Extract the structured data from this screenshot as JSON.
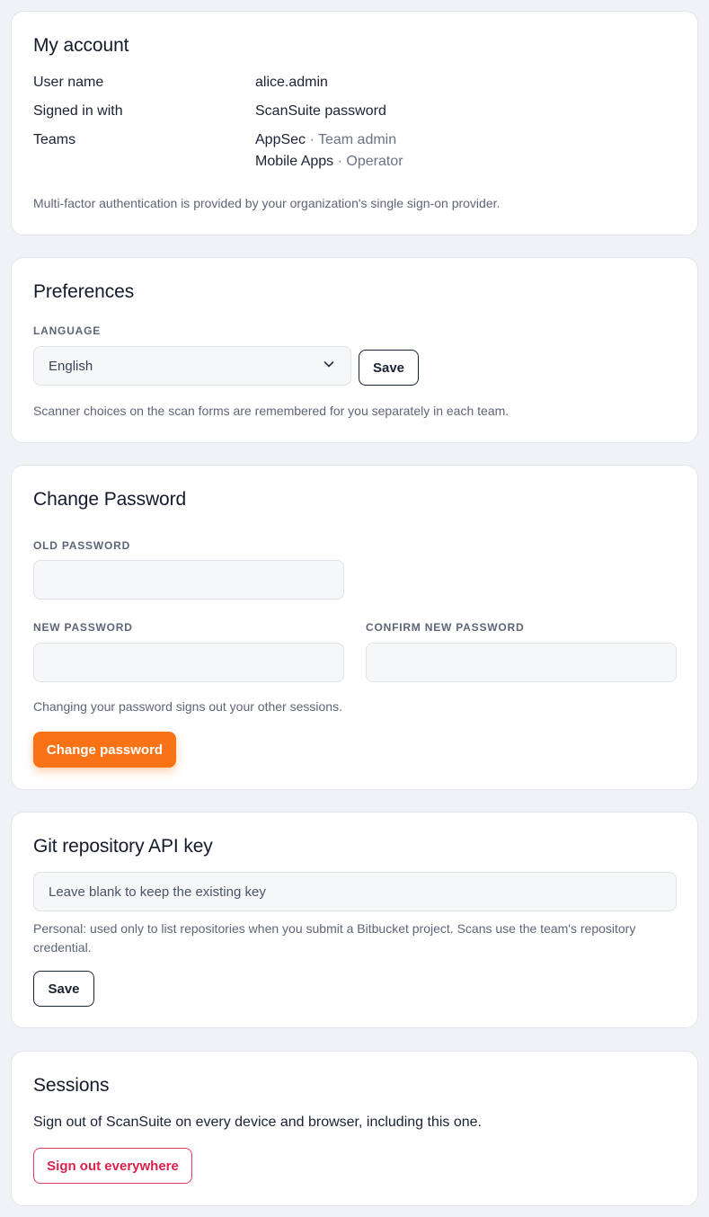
{
  "account": {
    "title": "My account",
    "rows": [
      {
        "key": "User name",
        "value": "alice.admin"
      },
      {
        "key": "Signed in with",
        "value": "ScanSuite password"
      },
      {
        "key": "Teams",
        "value": ""
      }
    ],
    "teams": [
      {
        "name": "AppSec",
        "sep": " · ",
        "role": "Team admin"
      },
      {
        "name": "Mobile Apps",
        "sep": " · ",
        "role": "Operator"
      }
    ],
    "mfa_note": "Multi-factor authentication is provided by your organization's single sign-on provider."
  },
  "preferences": {
    "title": "Preferences",
    "language_label": "LANGUAGE",
    "language_value": "English",
    "save_label": "Save",
    "note": "Scanner choices on the scan forms are remembered for you separately in each team."
  },
  "password": {
    "title": "Change Password",
    "old_label": "OLD PASSWORD",
    "new_label": "NEW PASSWORD",
    "confirm_label": "CONFIRM NEW PASSWORD",
    "note": "Changing your password signs out your other sessions.",
    "button_label": "Change password",
    "accent": "#f97316"
  },
  "git": {
    "title": "Git repository API key",
    "placeholder": "Leave blank to keep the existing key",
    "note": "Personal: used only to list repositories when you submit a Bitbucket project. Scans use the team's repository credential.",
    "save_label": "Save"
  },
  "sessions": {
    "title": "Sessions",
    "description": "Sign out of ScanSuite on every device and browser, including this one.",
    "button_label": "Sign out everywhere",
    "danger": "#d9224c"
  }
}
